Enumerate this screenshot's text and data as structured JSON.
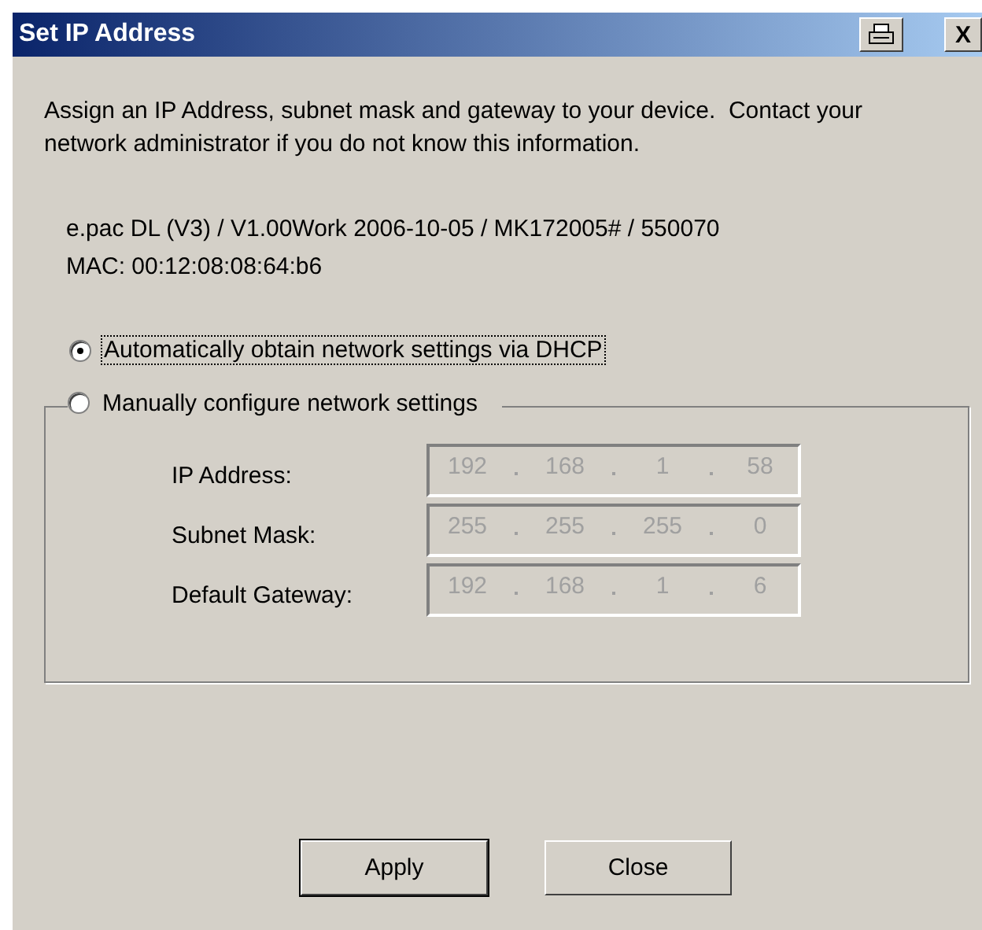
{
  "window": {
    "title": "Set IP Address",
    "title_buttons": [
      {
        "kind": "print"
      },
      {
        "kind": "close",
        "label": "X"
      }
    ]
  },
  "intro": "Assign an IP Address, subnet mask and gateway to your device.  Contact your network administrator if you do not know this information.",
  "device_info": [
    "e.pac DL (V3) / V1.00Work 2006-10-05 / MK172005# / 550070",
    "MAC: 00:12:08:08:64:b6"
  ],
  "radios": [
    {
      "label": "Automatically obtain network settings via DHCP",
      "selected": true,
      "focused": true
    },
    {
      "label": "Manually configure network settings",
      "selected": false,
      "focused": false
    }
  ],
  "fields": [
    {
      "label": "IP Address:",
      "octets": [
        "192",
        "168",
        "1",
        "58"
      ],
      "disabled": true
    },
    {
      "label": "Subnet Mask:",
      "octets": [
        "255",
        "255",
        "255",
        "0"
      ],
      "disabled": true
    },
    {
      "label": "Default Gateway:",
      "octets": [
        "192",
        "168",
        "1",
        "6"
      ],
      "disabled": true
    }
  ],
  "buttons": [
    {
      "label": "Apply",
      "default": true
    },
    {
      "label": "Close",
      "default": false
    }
  ]
}
